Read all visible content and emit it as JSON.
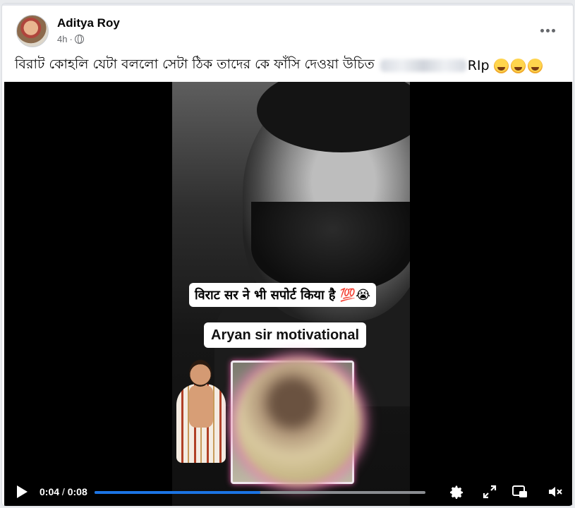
{
  "post": {
    "author": "Aditya Roy",
    "time": "4h",
    "dot": "·",
    "audience_icon": "globe-icon",
    "more_icon": "more-dots-icon",
    "caption_text": "বিরাট কোহলি যেটা বললো সেটা ঠিক তাদের কে ফাঁসি দেওয়া উচিত",
    "caption_suffix": "RIp",
    "caption_emoji_count": 3
  },
  "video": {
    "overlay_hindi": "विराट सर ने भी सपोर्ट किया है 💯😭",
    "overlay_title": "Aryan sir motivational",
    "time_current": "0:04",
    "time_separator": "/",
    "time_total": "0:08",
    "progress_fraction": 0.5,
    "colors": {
      "progress": "#1b74e4",
      "glow": "#f07ab6"
    },
    "control_icons": [
      "play-icon",
      "gear-icon",
      "expand-icon",
      "pip-icon",
      "mute-icon"
    ]
  }
}
